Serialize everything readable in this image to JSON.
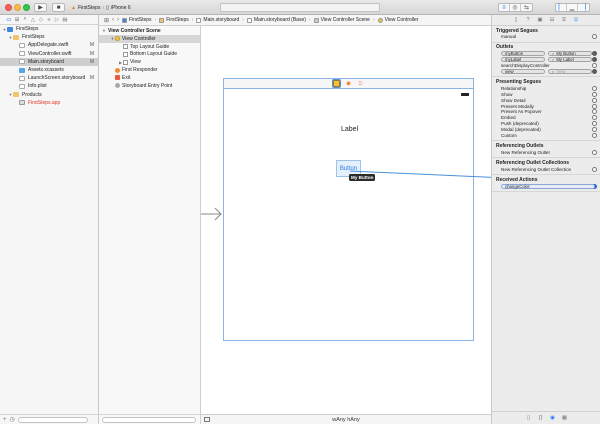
{
  "toolbar": {
    "scheme_target": "FirstSteps",
    "scheme_device": "iPhone 6"
  },
  "navigator": {
    "items": [
      {
        "name": "FirstSteps",
        "icon": "project-icon",
        "level": 0,
        "badge": "",
        "open": true
      },
      {
        "name": "FirstSteps",
        "icon": "folder-icon",
        "level": 1,
        "badge": "",
        "open": true
      },
      {
        "name": "AppDelegate.swift",
        "icon": "swift-file-icon",
        "level": 2,
        "badge": "M"
      },
      {
        "name": "ViewController.swift",
        "icon": "swift-file-icon",
        "level": 2,
        "badge": "M"
      },
      {
        "name": "Main.storyboard",
        "icon": "storyboard-file-icon",
        "level": 2,
        "badge": "M",
        "selected": true
      },
      {
        "name": "Assets.xcassets",
        "icon": "asset-catalog-icon",
        "level": 2,
        "badge": ""
      },
      {
        "name": "LaunchScreen.storyboard",
        "icon": "storyboard-file-icon",
        "level": 2,
        "badge": "M"
      },
      {
        "name": "Info.plist",
        "icon": "plist-file-icon",
        "level": 2,
        "badge": ""
      },
      {
        "name": "Products",
        "icon": "folder-icon",
        "level": 1,
        "badge": "",
        "open": true
      },
      {
        "name": "FirstSteps.app",
        "icon": "app-product-icon",
        "level": 2,
        "badge": "",
        "missing": true
      }
    ]
  },
  "jumpbar": {
    "crumbs": [
      "FirstSteps",
      "FirstSteps",
      "Main.storyboard",
      "Main.storyboard (Base)",
      "View Controller Scene",
      "View Controller"
    ]
  },
  "outline": {
    "scene_title": "View Controller Scene",
    "items": [
      {
        "name": "View Controller",
        "icon": "view-controller-icon",
        "level": 1,
        "open": true,
        "selected": true
      },
      {
        "name": "Top Layout Guide",
        "icon": "layout-guide-icon",
        "level": 2
      },
      {
        "name": "Bottom Layout Guide",
        "icon": "layout-guide-icon",
        "level": 2
      },
      {
        "name": "View",
        "icon": "view-icon",
        "level": 2,
        "closed": true
      },
      {
        "name": "First Responder",
        "icon": "first-responder-icon",
        "level": 1
      },
      {
        "name": "Exit",
        "icon": "exit-icon",
        "level": 1
      },
      {
        "name": "Storyboard Entry Point",
        "icon": "entry-point-icon",
        "level": 1
      }
    ]
  },
  "canvas": {
    "label_text": "Label",
    "button_text": "Button",
    "tooltip_text": "My Button",
    "size_class": "wAny hAny"
  },
  "inspector": {
    "sections": [
      {
        "title": "Triggered Segues",
        "rows": [
          {
            "label": "manual",
            "state": "empty"
          }
        ]
      },
      {
        "title": "Outlets",
        "rows": [
          {
            "outlet": "myButton",
            "target": "My Button",
            "state": "filled"
          },
          {
            "outlet": "myLabel",
            "target": "My Label",
            "state": "filled"
          },
          {
            "label": "searchDisplayController",
            "state": "empty"
          },
          {
            "outlet": "view",
            "target": "View",
            "state": "filled",
            "dim": true
          }
        ]
      },
      {
        "title": "Presenting Segues",
        "rows": [
          {
            "label": "Relationship",
            "state": "empty"
          },
          {
            "label": "Show",
            "state": "empty"
          },
          {
            "label": "Show Detail",
            "state": "empty"
          },
          {
            "label": "Present Modally",
            "state": "empty"
          },
          {
            "label": "Present As Popover",
            "state": "empty"
          },
          {
            "label": "Embed",
            "state": "empty"
          },
          {
            "label": "Push (deprecated)",
            "state": "empty"
          },
          {
            "label": "Modal (deprecated)",
            "state": "empty"
          },
          {
            "label": "Custom",
            "state": "empty"
          }
        ]
      },
      {
        "title": "Referencing Outlets",
        "rows": [
          {
            "label": "New Referencing Outlet",
            "state": "empty"
          }
        ]
      },
      {
        "title": "Referencing Outlet Collections",
        "rows": [
          {
            "label": "New Referencing Outlet Collection",
            "state": "empty"
          }
        ]
      },
      {
        "title": "Received Actions",
        "rows": [
          {
            "action": "changeColor:",
            "state": "blue"
          }
        ]
      }
    ]
  },
  "colors": {
    "selection_blue": "#1a75ff",
    "connection_line": "#4a90d9",
    "missing_file": "#e0352b"
  }
}
